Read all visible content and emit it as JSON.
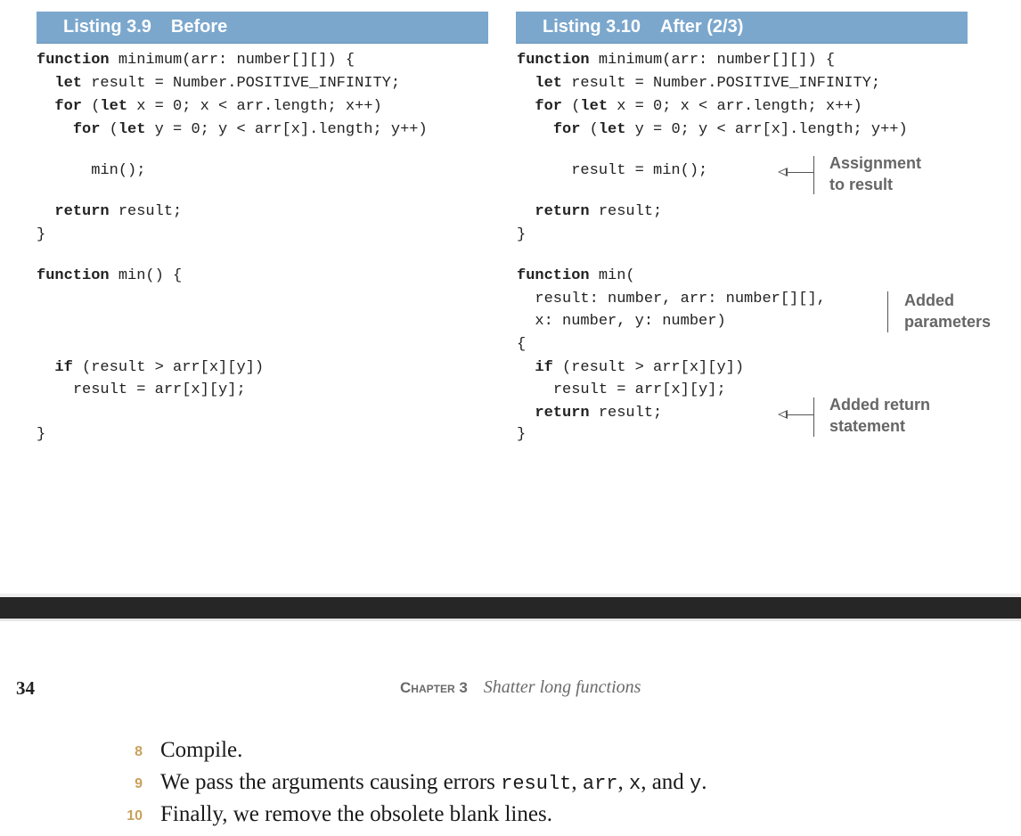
{
  "listings": [
    {
      "number": "Listing 3.9",
      "title": "Before",
      "lines": [
        {
          "kw": "function",
          "rest": " minimum(arr: number[][]) {"
        },
        {
          "indent": "  ",
          "kw": "let",
          "rest": " result = Number.POSITIVE_INFINITY;"
        },
        {
          "indent": "  ",
          "kw": "for",
          "rest": " (",
          "kw2": "let",
          "rest2": " x = 0; x < arr.length; x++)"
        },
        {
          "indent": "    ",
          "kw": "for",
          "rest": " (",
          "kw2": "let",
          "rest2": " y = 0; y < arr[x].length; y++)"
        },
        {
          "indent": "      ",
          "rest": "min();"
        },
        {
          "indent": "  ",
          "kw": "return",
          "rest": " result;"
        },
        {
          "rest": "}"
        },
        {
          "kw": "function",
          "rest": " min() {"
        },
        {
          "indent": "  ",
          "kw": "if",
          "rest": " (result > arr[x][y])"
        },
        {
          "indent": "    ",
          "rest": "result = arr[x][y];"
        },
        {
          "rest": "}"
        }
      ]
    },
    {
      "number": "Listing 3.10",
      "title": "After (2/3)",
      "lines": [
        {
          "kw": "function",
          "rest": " minimum(arr: number[][]) {"
        },
        {
          "indent": "  ",
          "kw": "let",
          "rest": " result = Number.POSITIVE_INFINITY;"
        },
        {
          "indent": "  ",
          "kw": "for",
          "rest": " (",
          "kw2": "let",
          "rest2": " x = 0; x < arr.length; x++)"
        },
        {
          "indent": "    ",
          "kw": "for",
          "rest": " (",
          "kw2": "let",
          "rest2": " y = 0; y < arr[x].length; y++)"
        },
        {
          "indent": "      ",
          "rest": "result = min();"
        },
        {
          "indent": "  ",
          "kw": "return",
          "rest": " result;"
        },
        {
          "rest": "}"
        },
        {
          "kw": "function",
          "rest": " min("
        },
        {
          "indent": "  ",
          "rest": "result: number, arr: number[][],"
        },
        {
          "indent": "  ",
          "rest": "x: number, y: number)"
        },
        {
          "rest": "{"
        },
        {
          "indent": "  ",
          "kw": "if",
          "rest": " (result > arr[x][y])"
        },
        {
          "indent": "    ",
          "rest": "result = arr[x][y];"
        },
        {
          "indent": "  ",
          "kw": "return",
          "rest": " result;"
        },
        {
          "rest": "}"
        }
      ],
      "annotations": [
        {
          "line1": "Assignment",
          "line2": "to result"
        },
        {
          "line1": "Added",
          "line2": "parameters"
        },
        {
          "line1": "Added return",
          "line2": "statement"
        }
      ]
    }
  ],
  "footer": {
    "page_number": "34",
    "chapter_label": "Chapter 3",
    "chapter_title": "Shatter long functions"
  },
  "steps": [
    {
      "num": "8",
      "parts": [
        {
          "t": "Compile."
        }
      ]
    },
    {
      "num": "9",
      "parts": [
        {
          "t": "We pass the arguments causing errors "
        },
        {
          "c": "result"
        },
        {
          "t": ", "
        },
        {
          "c": "arr"
        },
        {
          "t": ", "
        },
        {
          "c": "x"
        },
        {
          "t": ", and "
        },
        {
          "c": "y"
        },
        {
          "t": "."
        }
      ]
    },
    {
      "num": "10",
      "parts": [
        {
          "t": "Finally, we remove the obsolete blank lines."
        }
      ]
    }
  ],
  "colors": {
    "listing_header_bg": "#7ba7cd",
    "step_number": "#c9a15d",
    "annotation_text": "#666666",
    "separator_band": "#262626"
  }
}
